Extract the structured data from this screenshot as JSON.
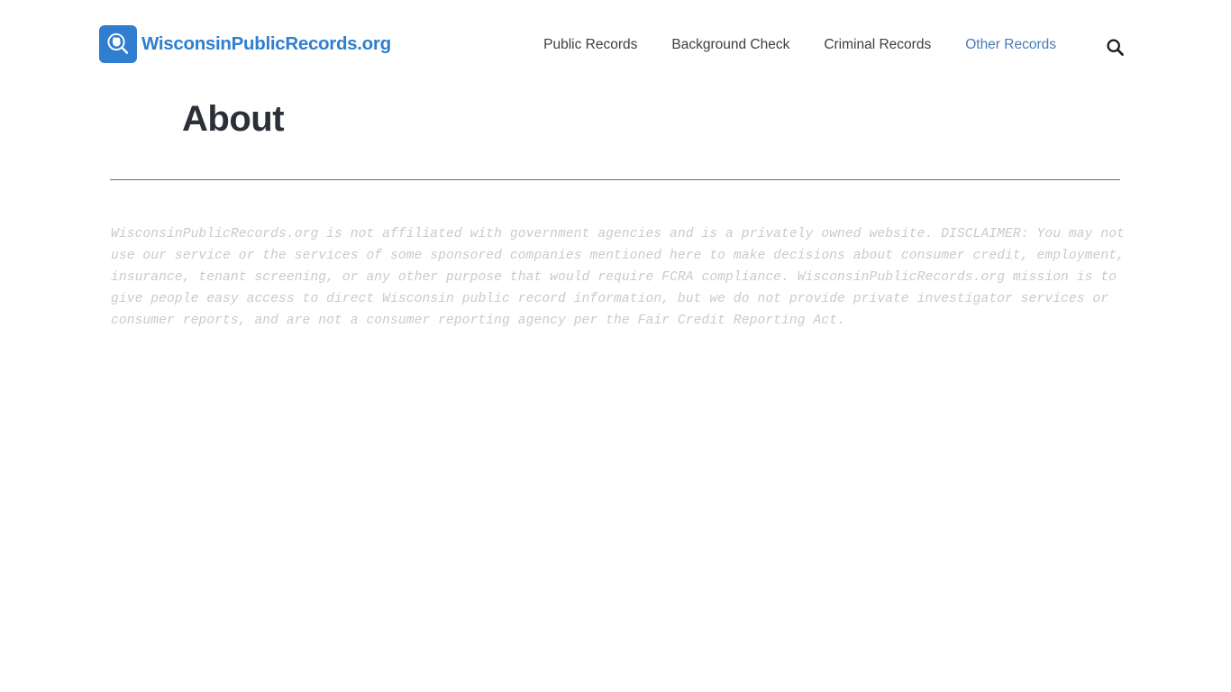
{
  "header": {
    "brand": {
      "logo_icon": "magnifier-wisconsin-icon",
      "name": "WisconsinPublicRecords.org",
      "logo_bg_color": "#2f7ed0",
      "text_color": "#2f7ed0"
    },
    "nav": {
      "items": [
        {
          "label": "Public Records",
          "active": false
        },
        {
          "label": "Background Check",
          "active": false
        },
        {
          "label": "Criminal Records",
          "active": false
        },
        {
          "label": "Other Records",
          "active": true
        }
      ],
      "active_color": "#4a7ab5",
      "default_color": "#3d3d3d"
    },
    "search": {
      "icon": "search-icon",
      "label": "Search"
    }
  },
  "main": {
    "title": "About",
    "title_color": "#2b2f38",
    "divider_color": "#6d6d6d",
    "disclaimer": "WisconsinPublicRecords.org is not affiliated with government agencies and is a privately owned website. DISCLAIMER: You may not use our service or the services of some sponsored companies mentioned here to make decisions about consumer credit, employment, insurance, tenant screening, or any other purpose that would require FCRA compliance. WisconsinPublicRecords.org mission is to give people easy access to direct Wisconsin public record information, but we do not provide private investigator services or consumer reports, and are not a consumer reporting agency per the Fair Credit Reporting Act.",
    "disclaimer_color": "#c9cace"
  }
}
